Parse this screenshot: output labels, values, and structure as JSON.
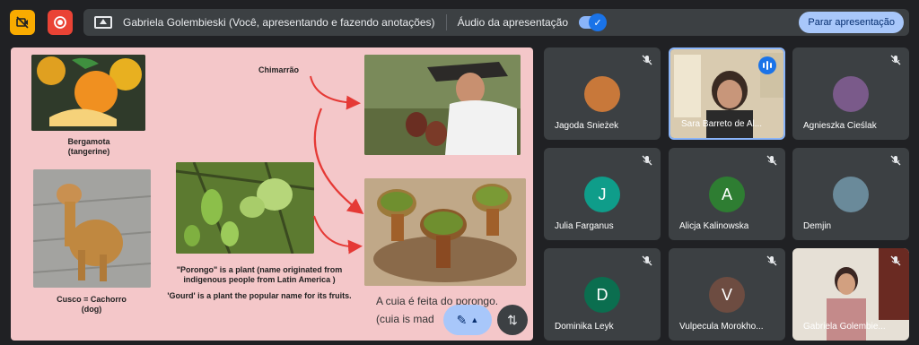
{
  "topbar": {
    "camera_icon": "camera-off-icon",
    "record_icon": "record-icon",
    "present_icon": "present-screen-icon",
    "presenting_text": "Gabriela Golembieski (Você, apresentando e fazendo anotações)",
    "audio_label": "Áudio da apresentação",
    "audio_enabled": true,
    "stop_button": "Parar apresentação"
  },
  "slide": {
    "chimarrao_label": "Chimarrão",
    "bergamota_label": "Bergamota\n(tangerine)",
    "cusco_label": "Cusco = Cachorro\n(dog)",
    "porongo_text": "\"Porongo\" is a plant (name originated from indigenous people from Latin America )",
    "gourd_text": "'Gourd'  is a plant the popular name for its fruits.",
    "cuia_text_line1": "A cuia é feita do porongo.",
    "cuia_text_line2": "(cuia is mad",
    "annotation_icon": "annotation-pen-icon",
    "expand_icon": "expand-arrows-icon"
  },
  "participants": [
    {
      "name": "Jagoda Śnieżek",
      "muted": true,
      "avatar": "photo-cat"
    },
    {
      "name": "Sara Barreto de Al...",
      "muted": false,
      "speaking": true,
      "avatar": "video"
    },
    {
      "name": "Agnieszka Cieślak",
      "muted": true,
      "avatar": "photo"
    },
    {
      "name": "Julia Farganus",
      "muted": true,
      "initial": "J",
      "color": "#0f9d8a"
    },
    {
      "name": "Alicja Kalinowska",
      "muted": true,
      "initial": "A",
      "color": "#2e7d32"
    },
    {
      "name": "Demjin",
      "muted": true,
      "avatar": "photo-landscape"
    },
    {
      "name": "Dominika Leyk",
      "muted": true,
      "initial": "D",
      "color": "#0b6e4f"
    },
    {
      "name": "Vulpecula Morokho...",
      "muted": true,
      "initial": "V",
      "color": "#6d4c41"
    },
    {
      "name": "Gabriela Golembie...",
      "muted": true,
      "avatar": "video-self"
    }
  ]
}
